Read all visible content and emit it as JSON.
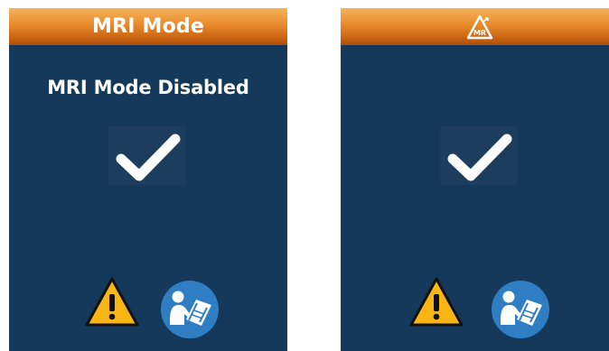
{
  "colors": {
    "screen_background": "#15395a",
    "header_gradient_top": "#f7b25a",
    "header_gradient_bottom": "#a94e08",
    "check_color": "#ffffff",
    "warning_yellow": "#f8b514",
    "manual_blue": "#2f7ec3"
  },
  "left_screen": {
    "header_title": "MRI Mode",
    "status_text": "MRI Mode Disabled",
    "center_icon": "checkmark-icon",
    "footer_icons": [
      "warning-icon",
      "consult-manual-icon"
    ]
  },
  "right_screen": {
    "header_icon": "mr-conditional-icon",
    "header_icon_label": "MR",
    "center_icon": "checkmark-icon",
    "footer_icons": [
      "warning-icon",
      "consult-manual-icon"
    ]
  }
}
